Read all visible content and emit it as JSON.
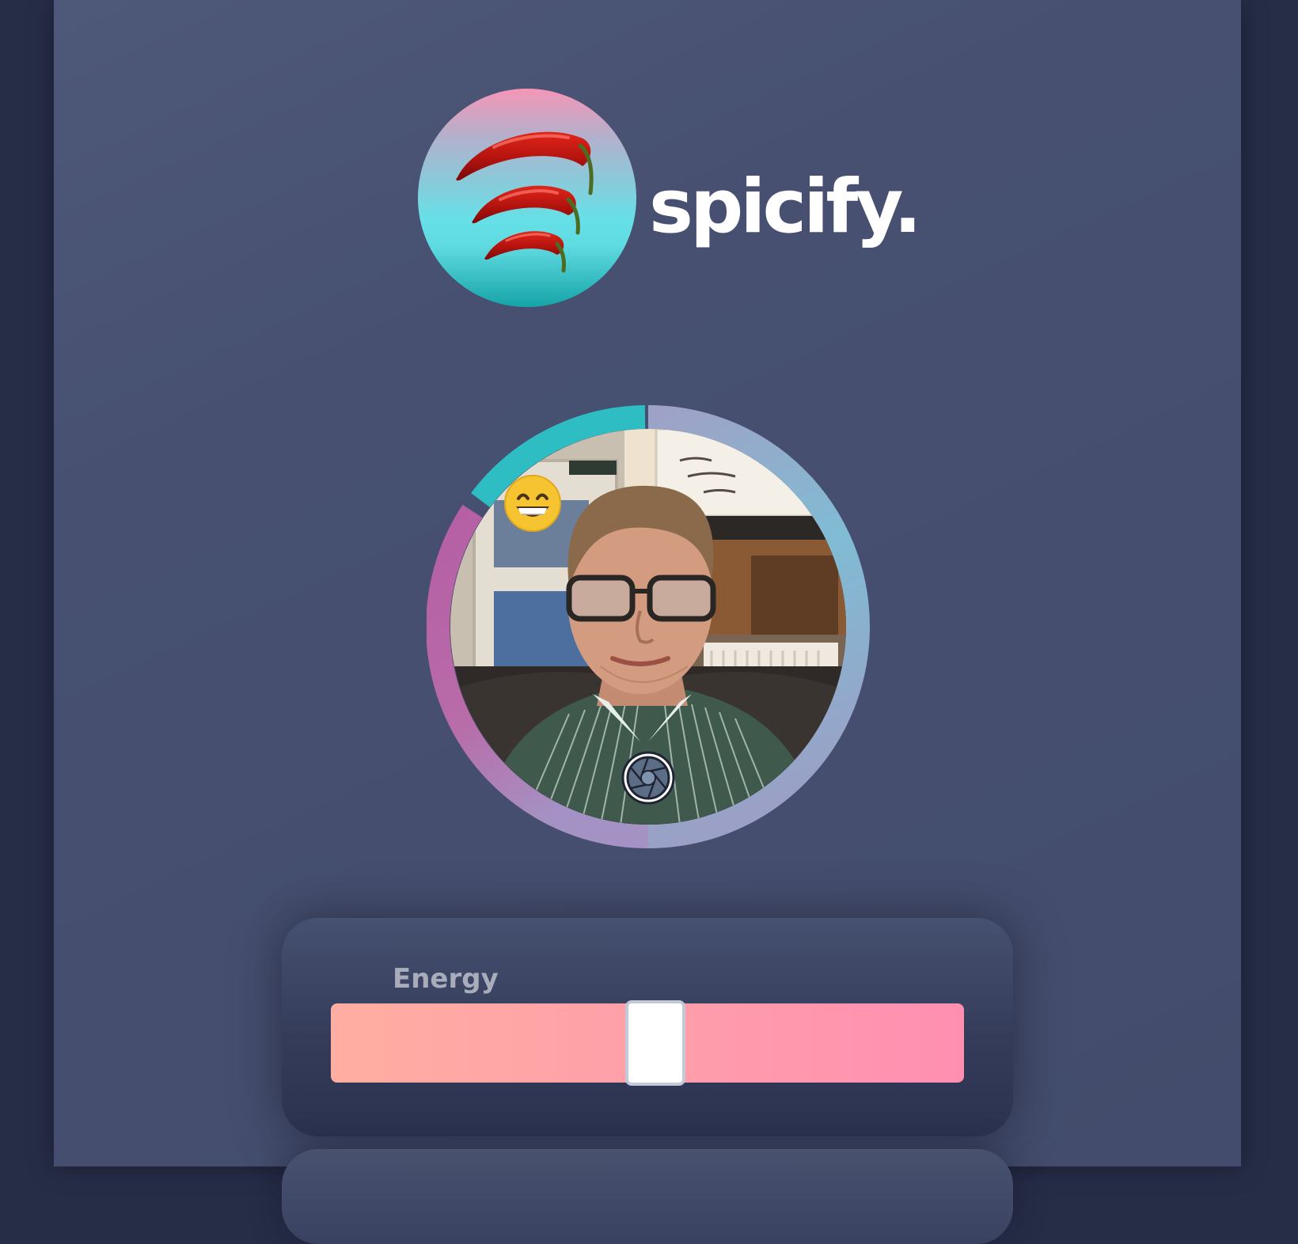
{
  "brand": {
    "name": "spicify.",
    "logo_icon": "chili-peppers-icon"
  },
  "camera": {
    "emotion_icon": "grinning-face-emoji",
    "emotion_glyph": "😁",
    "capture_icon": "camera-shutter-icon",
    "ring_colors": {
      "top": "#2dbdc2",
      "left": "#b662a8",
      "right": "#7fc0d4",
      "bottom": "#a78dc0"
    }
  },
  "controls": {
    "sliders": [
      {
        "label": "Energy",
        "value": 0.51,
        "track_colors": [
          "#ffaea1",
          "#ff8fb1"
        ]
      }
    ]
  }
}
